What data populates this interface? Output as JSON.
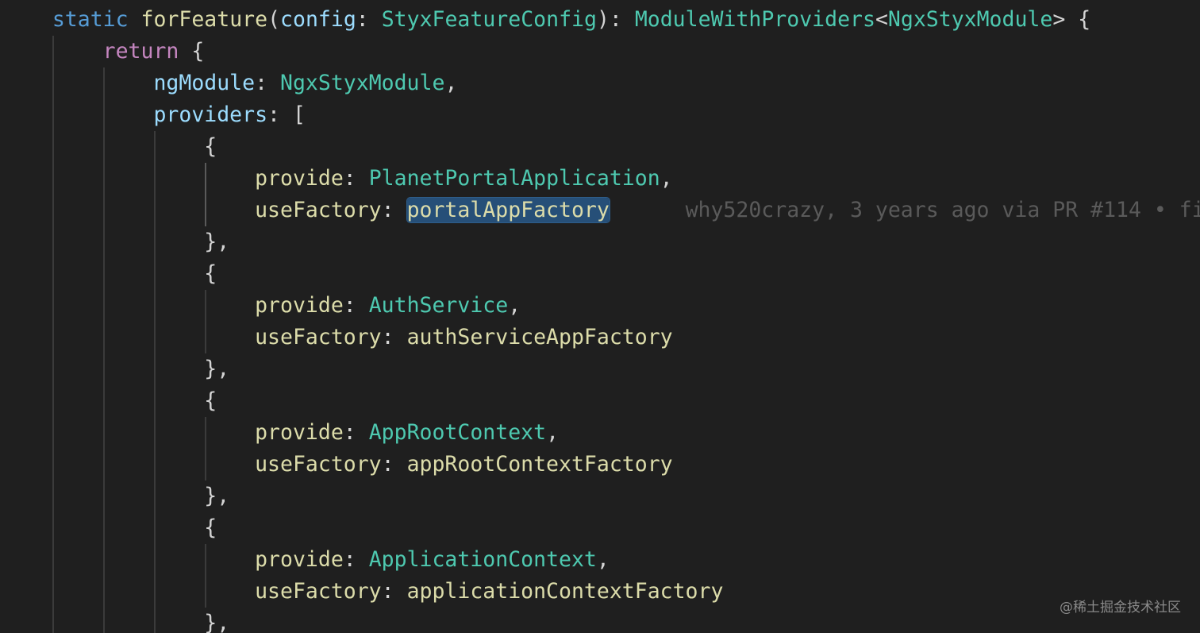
{
  "editor": {
    "lines": [
      {
        "indent": "    ",
        "tokens": [
          [
            "kw",
            "static"
          ],
          [
            "punc",
            " "
          ],
          [
            "fn",
            "forFeature"
          ],
          [
            "punc",
            "("
          ],
          [
            "var",
            "config"
          ],
          [
            "punc",
            ": "
          ],
          [
            "type",
            "StyxFeatureConfig"
          ],
          [
            "punc",
            "): "
          ],
          [
            "type",
            "ModuleWithProviders"
          ],
          [
            "punc",
            "<"
          ],
          [
            "type",
            "NgxStyxModule"
          ],
          [
            "punc",
            "> {"
          ]
        ]
      },
      {
        "indent": "        ",
        "tokens": [
          [
            "ctrl",
            "return"
          ],
          [
            "punc",
            " {"
          ]
        ]
      },
      {
        "indent": "            ",
        "tokens": [
          [
            "var",
            "ngModule"
          ],
          [
            "punc",
            ": "
          ],
          [
            "type",
            "NgxStyxModule"
          ],
          [
            "punc",
            ","
          ]
        ]
      },
      {
        "indent": "            ",
        "tokens": [
          [
            "var",
            "providers"
          ],
          [
            "punc",
            ": ["
          ]
        ]
      },
      {
        "indent": "                ",
        "tokens": [
          [
            "punc",
            "{"
          ]
        ]
      },
      {
        "indent": "                    ",
        "tokens": [
          [
            "fn",
            "provide"
          ],
          [
            "punc",
            ": "
          ],
          [
            "type",
            "PlanetPortalApplication"
          ],
          [
            "punc",
            ","
          ]
        ]
      },
      {
        "indent": "                    ",
        "tokens": [
          [
            "fn",
            "useFactory"
          ],
          [
            "punc",
            ": "
          ],
          [
            "fn hl",
            "portalAppFactory"
          ],
          [
            "blame",
            "      why520crazy, 3 years ago via PR #114 • fi"
          ]
        ]
      },
      {
        "indent": "                ",
        "tokens": [
          [
            "punc",
            "},"
          ]
        ]
      },
      {
        "indent": "                ",
        "tokens": [
          [
            "punc",
            "{"
          ]
        ]
      },
      {
        "indent": "                    ",
        "tokens": [
          [
            "fn",
            "provide"
          ],
          [
            "punc",
            ": "
          ],
          [
            "type",
            "AuthService"
          ],
          [
            "punc",
            ","
          ]
        ]
      },
      {
        "indent": "                    ",
        "tokens": [
          [
            "fn",
            "useFactory"
          ],
          [
            "punc",
            ": "
          ],
          [
            "fn",
            "authServiceAppFactory"
          ]
        ]
      },
      {
        "indent": "                ",
        "tokens": [
          [
            "punc",
            "},"
          ]
        ]
      },
      {
        "indent": "                ",
        "tokens": [
          [
            "punc",
            "{"
          ]
        ]
      },
      {
        "indent": "                    ",
        "tokens": [
          [
            "fn",
            "provide"
          ],
          [
            "punc",
            ": "
          ],
          [
            "type",
            "AppRootContext"
          ],
          [
            "punc",
            ","
          ]
        ]
      },
      {
        "indent": "                    ",
        "tokens": [
          [
            "fn",
            "useFactory"
          ],
          [
            "punc",
            ": "
          ],
          [
            "fn",
            "appRootContextFactory"
          ]
        ]
      },
      {
        "indent": "                ",
        "tokens": [
          [
            "punc",
            "},"
          ]
        ]
      },
      {
        "indent": "                ",
        "tokens": [
          [
            "punc",
            "{"
          ]
        ]
      },
      {
        "indent": "                    ",
        "tokens": [
          [
            "fn",
            "provide"
          ],
          [
            "punc",
            ": "
          ],
          [
            "type",
            "ApplicationContext"
          ],
          [
            "punc",
            ","
          ]
        ]
      },
      {
        "indent": "                    ",
        "tokens": [
          [
            "fn",
            "useFactory"
          ],
          [
            "punc",
            ": "
          ],
          [
            "fn",
            "applicationContextFactory"
          ]
        ]
      },
      {
        "indent": "                ",
        "tokens": [
          [
            "punc",
            "},"
          ]
        ]
      }
    ],
    "blame": {
      "author": "why520crazy",
      "when": "3 years ago",
      "via": "via PR #114",
      "suffix": "• fi"
    },
    "highlighted_word": "portalAppFactory"
  },
  "watermark": "@稀土掘金技术社区",
  "colors": {
    "background": "#1f1f1f",
    "keyword": "#569cd6",
    "control": "#c586c0",
    "function": "#dcdcaa",
    "variable": "#9cdcfe",
    "type": "#4ec9b0",
    "punctuation": "#d4d4d4",
    "selection": "#264f78",
    "blame": "#5a5a5a"
  }
}
